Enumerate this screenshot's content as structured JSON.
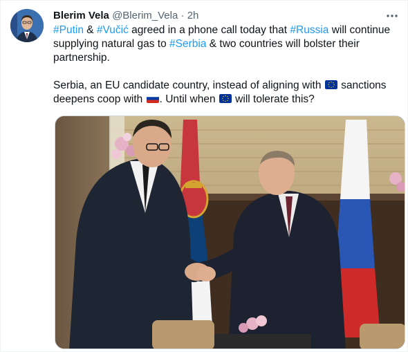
{
  "author": {
    "name": "Blerim Vela",
    "handle": "@Blerim_Vela",
    "separator": "·",
    "time": "2h"
  },
  "tweet": {
    "segments_line": [
      {
        "text": "#Putin",
        "type": "hashtag"
      },
      {
        "text": " & ",
        "type": "text"
      },
      {
        "text": "#Vučić",
        "type": "hashtag"
      },
      {
        "text": " agreed in a phone call today that ",
        "type": "text"
      },
      {
        "text": "#Russia",
        "type": "hashtag"
      },
      {
        "text": " will continue supplying natural gas to ",
        "type": "text"
      },
      {
        "text": "#Serbia",
        "type": "hashtag"
      },
      {
        "text": " & two countries will bolster their partnership.",
        "type": "text"
      }
    ],
    "p1": {
      "tag_putin": "#Putin",
      "amp1": " & ",
      "tag_vucic": "#Vučić",
      "t1": " agreed in a phone call today that ",
      "tag_russia": "#Russia",
      "t2": " will continue supplying natural gas to ",
      "tag_serbia": "#Serbia",
      "t3": " & two countries will bolster their partnership."
    },
    "p2": {
      "t1": "Serbia, an EU candidate country, instead of aligning with ",
      "t2": " sanctions deepens coop with ",
      "t3": ". Until when ",
      "t4": " will tolerate this?"
    },
    "emoji": [
      "eu-flag-emoji",
      "russia-flag-emoji",
      "eu-flag-emoji"
    ]
  },
  "colors": {
    "hashtag": "#1d9bf0",
    "text": "#0f1419",
    "secondary": "#536471",
    "eu_blue": "#003399",
    "eu_gold": "#ffcc00",
    "russia_white": "#ffffff",
    "russia_blue": "#0039a6",
    "russia_red": "#d52b1e",
    "serbia_red": "#c6363c",
    "serbia_blue": "#0c4076"
  },
  "icons": {
    "more": "more-horizontal-icon"
  }
}
